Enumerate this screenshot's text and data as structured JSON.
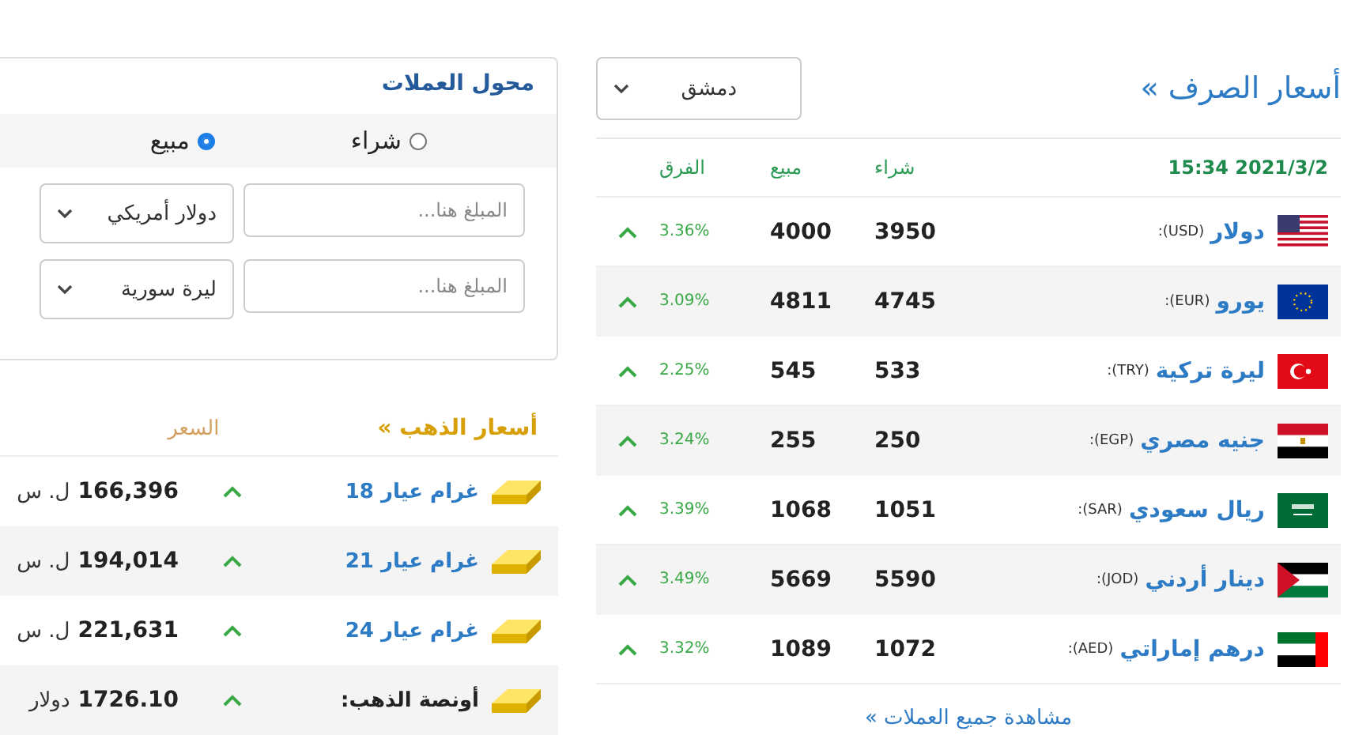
{
  "exchange": {
    "title": "أسعار الصرف »",
    "city": "دمشق",
    "date": "15:34 2021/3/2",
    "columns": [
      "شراء",
      "مبيع",
      "الفرق"
    ],
    "rows": [
      {
        "name": "دولار",
        "code": "(USD):",
        "buy": "3950",
        "sell": "4000",
        "change": "3.36%",
        "rising": true
      },
      {
        "name": "يورو",
        "code": "(EUR):",
        "buy": "4745",
        "sell": "4811",
        "change": "3.09%",
        "rising": true
      },
      {
        "name": "ليرة تركية",
        "code": "(TRY):",
        "buy": "533",
        "sell": "545",
        "change": "2.25%",
        "rising": true
      },
      {
        "name": "جنيه مصري",
        "code": "(EGP):",
        "buy": "250",
        "sell": "255",
        "change": "3.24%",
        "rising": true
      },
      {
        "name": "ريال سعودي",
        "code": "(SAR):",
        "buy": "1051",
        "sell": "1068",
        "change": "3.39%",
        "rising": true
      },
      {
        "name": "دينار أردني",
        "code": "(JOD):",
        "buy": "5590",
        "sell": "5669",
        "change": "3.49%",
        "rising": true
      },
      {
        "name": "درهم إماراتي",
        "code": "(AED):",
        "buy": "1072",
        "sell": "1089",
        "change": "3.32%",
        "rising": true
      }
    ],
    "more_link": "مشاهدة جميع العملات »"
  },
  "converter": {
    "title": "محول العملات",
    "modes": [
      {
        "label": "شراء",
        "selected": false
      },
      {
        "label": "مبيع",
        "selected": true
      }
    ],
    "lines": [
      {
        "placeholder": "المبلغ هنا...",
        "currency": "دولار أمريكي"
      },
      {
        "placeholder": "المبلغ هنا...",
        "currency": "ليرة سورية"
      }
    ]
  },
  "gold": {
    "title": "أسعار الذهب »",
    "price_column": "السعر",
    "rows": [
      {
        "kind": "gram",
        "label": "غرام عيار 18",
        "price": "166,396",
        "unit": "ل. س",
        "rising": true
      },
      {
        "kind": "gram",
        "label": "غرام عيار 21",
        "price": "194,014",
        "unit": "ل. س",
        "rising": true
      },
      {
        "kind": "gram",
        "label": "غرام عيار 24",
        "price": "221,631",
        "unit": "ل. س",
        "rising": true
      },
      {
        "kind": "ounce",
        "label": "أونصة الذهب:",
        "price": "1726.10",
        "unit": "دولار",
        "rising": true
      }
    ]
  }
}
